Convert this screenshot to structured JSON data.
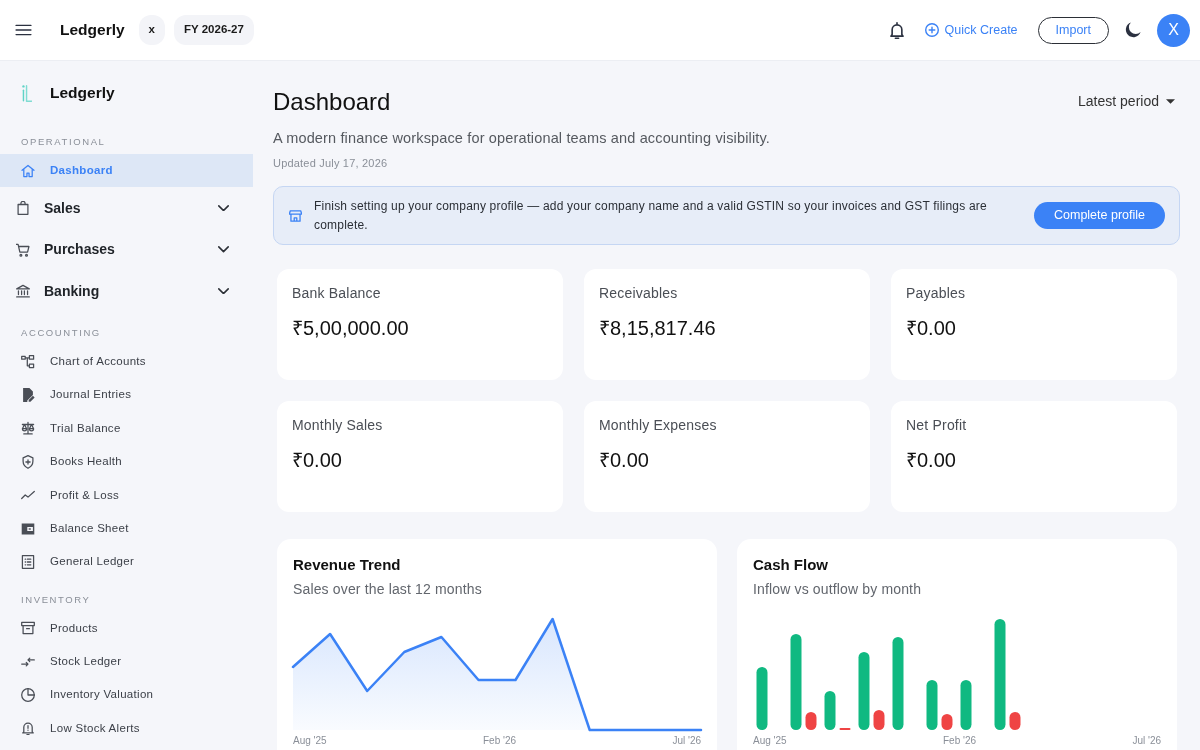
{
  "top_bar": {
    "brand": "Ledgerly",
    "chips": [
      "x",
      "FY 2026-27"
    ],
    "quick_create": "Quick Create",
    "import_button": "Import",
    "avatar": "X"
  },
  "sidebar": {
    "brand": "Ledgerly",
    "sections": [
      {
        "heading": "OPERATIONAL",
        "items": [
          {
            "label": "Dashboard",
            "kind": "link",
            "selected": true
          },
          {
            "label": "Sales",
            "kind": "group",
            "selected": false,
            "expanded": false
          },
          {
            "label": "Purchases",
            "kind": "group",
            "selected": false,
            "expanded": false
          },
          {
            "label": "Banking",
            "kind": "group",
            "selected": false,
            "expanded": false
          }
        ]
      },
      {
        "heading": "ACCOUNTING",
        "items": [
          {
            "label": "Chart of Accounts",
            "kind": "link",
            "selected": false
          },
          {
            "label": "Journal Entries",
            "kind": "link",
            "selected": false
          },
          {
            "label": "Trial Balance",
            "kind": "link",
            "selected": false
          },
          {
            "label": "Books Health",
            "kind": "link",
            "selected": false
          },
          {
            "label": "Profit & Loss",
            "kind": "link",
            "selected": false
          },
          {
            "label": "Balance Sheet",
            "kind": "link",
            "selected": false
          },
          {
            "label": "General Ledger",
            "kind": "link",
            "selected": false
          }
        ]
      },
      {
        "heading": "INVENTORY",
        "items": [
          {
            "label": "Products",
            "kind": "link",
            "selected": false
          },
          {
            "label": "Stock Ledger",
            "kind": "link",
            "selected": false
          },
          {
            "label": "Inventory Valuation",
            "kind": "link",
            "selected": false
          },
          {
            "label": "Low Stock Alerts",
            "kind": "link",
            "selected": false
          }
        ]
      }
    ]
  },
  "page": {
    "title": "Dashboard",
    "period_select": "Latest period",
    "subtitle": "A modern finance workspace for operational teams and accounting visibility.",
    "updated": "Updated July 17, 2026"
  },
  "notice": {
    "text": "Finish setting up your company profile — add your company name and a valid GSTIN so your invoices and GST filings are complete.",
    "button": "Complete profile"
  },
  "stats": [
    {
      "label": "Bank Balance",
      "value": "₹5,00,000.00"
    },
    {
      "label": "Receivables",
      "value": "₹8,15,817.46"
    },
    {
      "label": "Payables",
      "value": "₹0.00"
    },
    {
      "label": "Monthly Sales",
      "value": "₹0.00"
    },
    {
      "label": "Monthly Expenses",
      "value": "₹0.00"
    },
    {
      "label": "Net Profit",
      "value": "₹0.00"
    }
  ],
  "charts": [
    {
      "kind": "line",
      "title": "Revenue Trend",
      "subtitle": "Sales over the last 12 months",
      "axis_labels": [
        "Aug '25",
        "Feb '26",
        "Jul '26"
      ]
    },
    {
      "kind": "bar",
      "title": "Cash Flow",
      "subtitle": "Inflow vs outflow by month",
      "axis_labels": [
        "Aug '25",
        "Feb '26",
        "Jul '26"
      ]
    }
  ]
}
